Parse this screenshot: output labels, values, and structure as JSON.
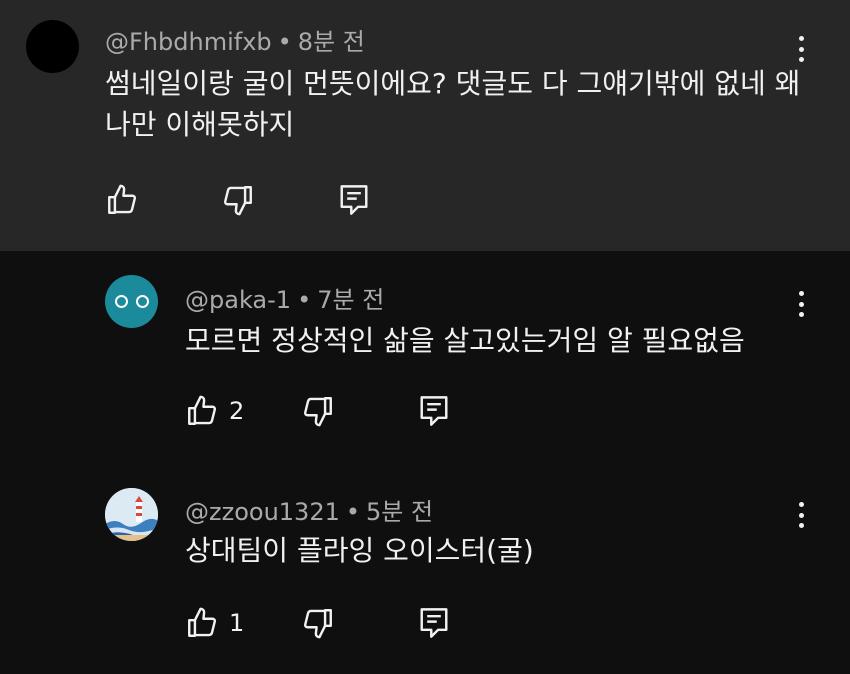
{
  "comments": [
    {
      "author": "@Fhbdhmifxb",
      "time": "8분 전",
      "text": "썸네일이랑 굴이 먼뜻이에요? 댓글도 다 그얘기밖에 없네 왜 나만 이해못하지",
      "likes": ""
    },
    {
      "author": "@paka-1",
      "time": "7분 전",
      "text": "모르면 정상적인 삶을 살고있는거임 알 필요없음",
      "likes": "2"
    },
    {
      "author": "@zzoou1321",
      "time": "5분 전",
      "text": "상대팀이 플라잉 오이스터(굴)",
      "likes": "1"
    }
  ],
  "separator": "•",
  "colors": {
    "highlight_bg": "#272727",
    "page_bg": "#0f0f0f",
    "meta_text": "#aaaaaa",
    "avatar_teal": "#1b8a9b"
  },
  "icons": [
    "thumb-up-icon",
    "thumb-down-icon",
    "reply-icon",
    "more-vert-icon"
  ]
}
